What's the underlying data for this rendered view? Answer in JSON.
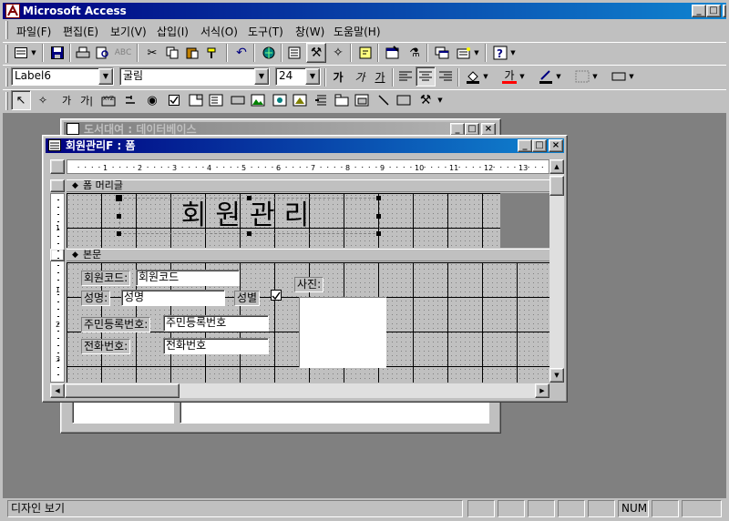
{
  "app": {
    "title": "Microsoft Access",
    "caption_buttons": [
      "_",
      "□",
      "×"
    ]
  },
  "menu": {
    "items": [
      "파일(F)",
      "편집(E)",
      "보기(V)",
      "삽입(I)",
      "서식(O)",
      "도구(T)",
      "창(W)",
      "도움말(H)"
    ]
  },
  "formatting": {
    "object_select": "Label6",
    "font_name": "굴림",
    "font_size": "24",
    "bold": "가",
    "italic": "가",
    "underline": "가",
    "font_color_glyph": "가"
  },
  "toolbox": {
    "label_tool": "가",
    "textbox_tool": "가|"
  },
  "back_window": {
    "title": "도서대여 : 데이터베이스"
  },
  "form_window": {
    "title": "회원관리F : 폼",
    "ruler_numbers": [
      "1",
      "2",
      "3",
      "4",
      "5",
      "6",
      "7",
      "8",
      "9",
      "10",
      "11",
      "12",
      "13"
    ],
    "vruler_numbers": [
      "1",
      "1",
      "2",
      "3"
    ],
    "sections": {
      "header": "폼 머리글",
      "detail": "본문"
    },
    "header_title": "회원관리",
    "controls": {
      "member_code_label": "회원코드:",
      "member_code_value": "회원코드",
      "name_label": "성명:",
      "name_value": "성명",
      "gender_label": "성별",
      "gender_checked": true,
      "photo_label": "사진:",
      "resident_no_label": "주민등록번호:",
      "resident_no_value": "주민등록번호",
      "phone_label": "전화번호:",
      "phone_value": "전화번호"
    }
  },
  "status_bar": {
    "mode": "디자인 보기",
    "num": "NUM"
  }
}
